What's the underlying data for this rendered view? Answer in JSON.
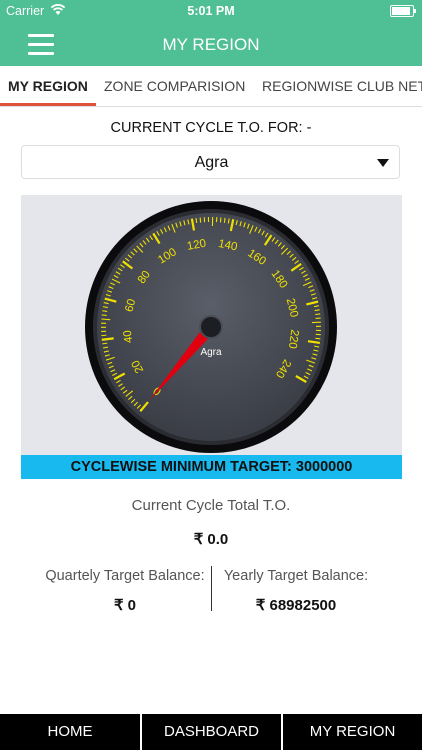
{
  "status_bar": {
    "carrier": "Carrier",
    "time": "5:01 PM"
  },
  "navbar": {
    "title": "MY REGION"
  },
  "tabs": [
    {
      "label": "MY REGION",
      "active": true
    },
    {
      "label": "ZONE COMPARISION",
      "active": false
    },
    {
      "label": "REGIONWISE CLUB NET",
      "active": false
    }
  ],
  "cycle": {
    "label": "CURRENT CYCLE T.O. FOR: -",
    "selected_region": "Agra"
  },
  "gauge": {
    "min": 0,
    "max": 240,
    "value": 0,
    "major_ticks": [
      "0",
      "20",
      "40",
      "60",
      "80",
      "100",
      "120",
      "140",
      "160",
      "180",
      "200",
      "220",
      "240"
    ],
    "center_label": "Agra",
    "colors": {
      "face": "#3a3d45",
      "tick": "#f0e000",
      "needle": "#e00010",
      "bezel": "#0b0b0d"
    }
  },
  "target_banner": "CYCLEWISE MINIMUM TARGET: 3000000",
  "current_total": {
    "label": "Current Cycle Total T.O.",
    "value": "₹ 0.0"
  },
  "quarterly": {
    "label": "Quartely Target Balance:",
    "value": "₹ 0"
  },
  "yearly": {
    "label": "Yearly Target Balance:",
    "value": "₹ 68982500"
  },
  "bottom_nav": [
    "HOME",
    "DASHBOARD",
    "MY REGION"
  ]
}
